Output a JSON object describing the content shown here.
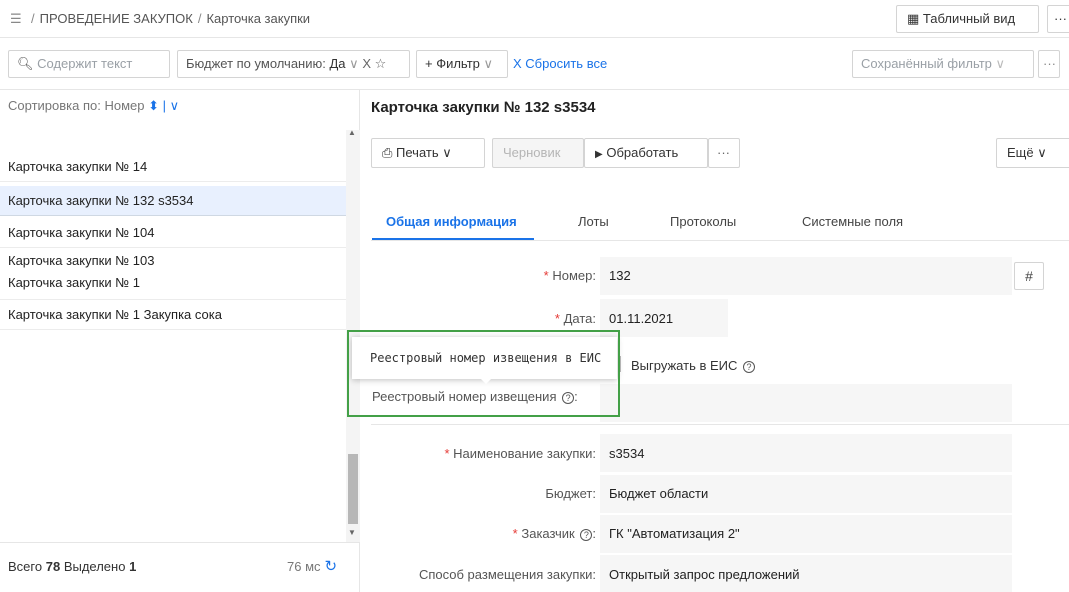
{
  "breadcrumb": {
    "section": "ПРОВЕДЕНИЕ ЗАКУПОК",
    "current": "Карточка закупки"
  },
  "toolbar": {
    "table_view_label": "Табличный вид",
    "more_label": "···"
  },
  "filters": {
    "search_placeholder": "Содержит текст",
    "budget_label": "Бюджет по умолчанию:",
    "budget_value": "Да",
    "add_filter_label": "+ Фильтр",
    "reset_label": "Сбросить все",
    "saved_filter_placeholder": "Сохранённый фильтр",
    "saved_more_label": "···"
  },
  "list": {
    "sort_label": "Сортировка по:",
    "sort_value": "Номер",
    "items": [
      {
        "label": "Карточка закупки № 14"
      },
      {
        "label": "Карточка закупки № 132 s3534"
      },
      {
        "label": "Карточка закупки № 104"
      },
      {
        "label": "Карточка закупки № 103"
      },
      {
        "label": "Карточка закупки № 1"
      },
      {
        "label": "Карточка закупки № 1 Закупка сока"
      }
    ],
    "selected_index": 1,
    "total_label": "Всего",
    "total_value": "78",
    "selected_label": "Выделено",
    "selected_value": "1",
    "timing": "76 мс"
  },
  "card": {
    "title": "Карточка закупки № 132 s3534",
    "print_label": "Печать",
    "draft_label": "Черновик",
    "process_label": "Обработать",
    "more_dots": "···",
    "more_label": "Ещё",
    "tabs": [
      {
        "label": "Общая информация"
      },
      {
        "label": "Лоты"
      },
      {
        "label": "Протоколы"
      },
      {
        "label": "Системные поля"
      }
    ],
    "fields": {
      "number_label": "Номер:",
      "number_value": "132",
      "date_label": "Дата:",
      "date_value": "01.11.2021",
      "eis_export_label": "Выгружать в ЕИС",
      "registry_label": "Реестровый номер извещения",
      "name_label": "Наименование закупки:",
      "name_value": "s3534",
      "budget_label": "Бюджет:",
      "budget_value": "Бюджет области",
      "customer_label": "Заказчик",
      "customer_value": "ГК \"Автоматизация 2\"",
      "method_label": "Способ размещения закупки:",
      "method_value": "Открытый запрос предложений"
    },
    "tooltip": "Реестровый номер извещения в ЕИС"
  }
}
